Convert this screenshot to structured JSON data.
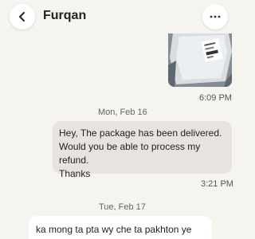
{
  "header": {
    "title": "Furqan",
    "back_icon": "chevron-left-icon",
    "more_icon": "ellipsis-icon"
  },
  "messages": [
    {
      "type": "image",
      "direction": "outgoing",
      "time": "6:09 PM"
    },
    {
      "type": "date",
      "label": "Mon, Feb 16"
    },
    {
      "type": "text",
      "direction": "outgoing",
      "lines": [
        "Hey, The package has been delivered.",
        "Would you be able to process my refund.",
        "Thanks"
      ],
      "time": "3:21 PM"
    },
    {
      "type": "date",
      "label": "Tue, Feb 17"
    },
    {
      "type": "text",
      "direction": "incoming",
      "lines": [
        "ka mong ta pta wy che ta pakhton ye"
      ]
    }
  ],
  "colors": {
    "background": "#f6f4ef",
    "outgoing_bubble": "#e7e4e0",
    "incoming_bubble": "#ffffff"
  }
}
